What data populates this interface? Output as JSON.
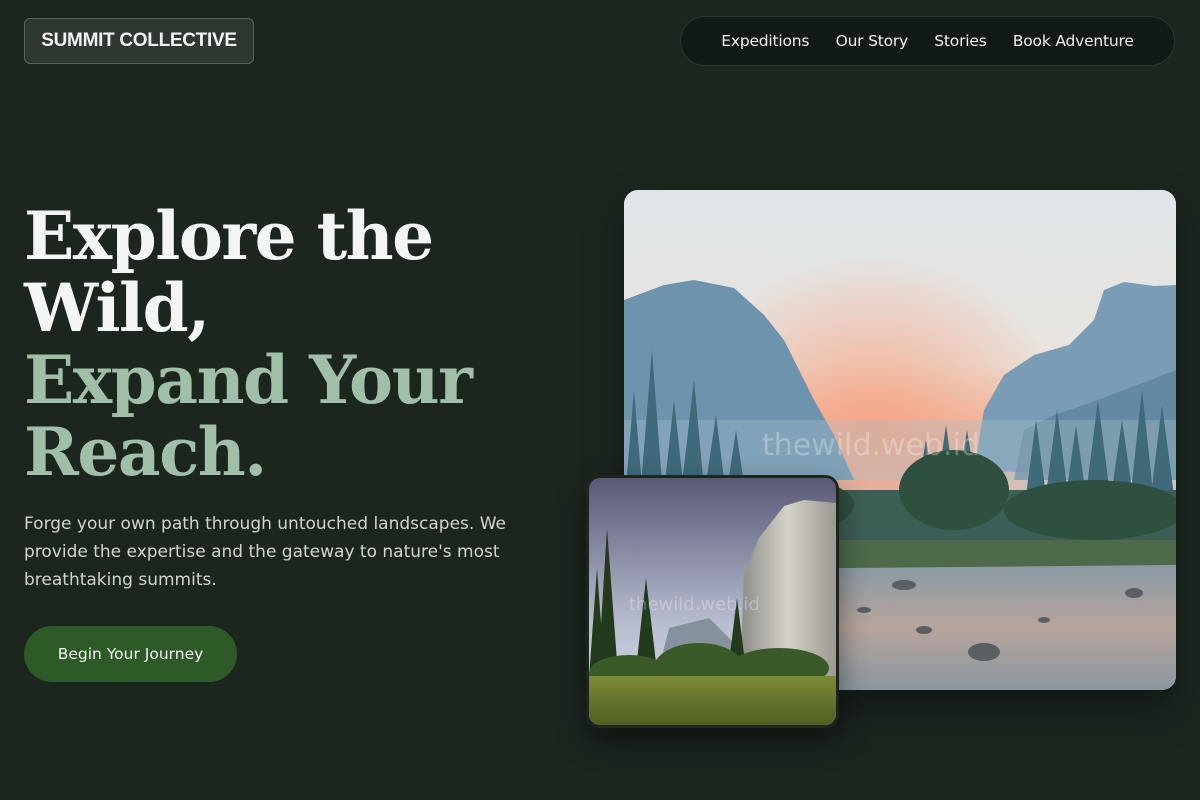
{
  "brand": {
    "logo_text": "SUMMIT COLLECTIVE"
  },
  "nav": {
    "items": [
      {
        "label": "Expeditions"
      },
      {
        "label": "Our Story"
      },
      {
        "label": "Stories"
      },
      {
        "label": "Book Adventure"
      }
    ]
  },
  "hero": {
    "headline_line1": "Explore the",
    "headline_line2": "Wild,",
    "headline_line3": "Expand Your",
    "headline_line4": "Reach.",
    "subtext": "Forge your own path through untouched landscapes. We provide the expertise and the gateway to nature's most breathtaking summits.",
    "cta_label": "Begin Your Journey"
  },
  "images": {
    "main_watermark": "thewild.web.id",
    "small_watermark": "thewild.web.id"
  },
  "colors": {
    "background": "#1c261f",
    "accent_green": "#2d5a27",
    "headline_light": "#f4f6f3",
    "headline_sage": "#9fbfa8"
  }
}
